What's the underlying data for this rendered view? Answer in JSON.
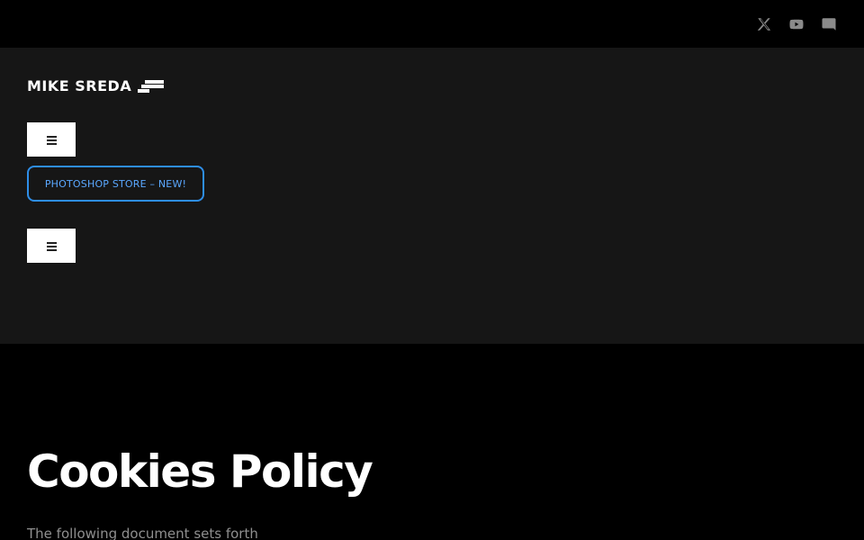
{
  "social": {
    "items": [
      {
        "icon": "x-twitter-icon"
      },
      {
        "icon": "youtube-icon"
      },
      {
        "icon": "discord-icon"
      }
    ],
    "icon_color": "#8a8a8a"
  },
  "header": {
    "logo_text": "MIKE SREDA",
    "store_button_label": "PHOTOSHOP STORE – NEW!",
    "store_button_color": "#2e8ee8",
    "background": "#161616"
  },
  "main": {
    "title": "Cookies Policy",
    "intro": "The following document sets forth"
  }
}
